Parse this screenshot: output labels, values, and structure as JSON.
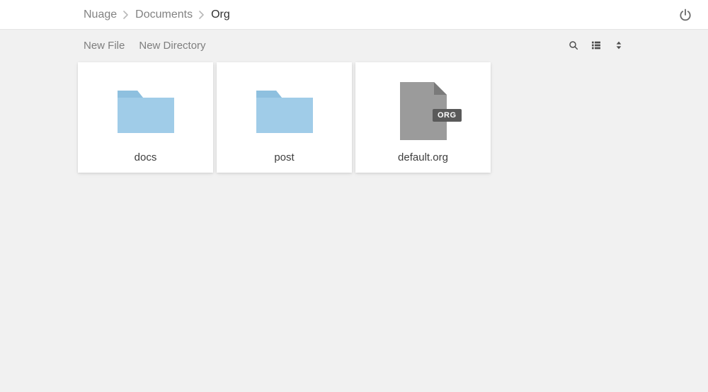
{
  "breadcrumb": {
    "items": [
      {
        "label": "Nuage",
        "current": false
      },
      {
        "label": "Documents",
        "current": false
      },
      {
        "label": "Org",
        "current": true
      }
    ]
  },
  "toolbar": {
    "new_file_label": "New File",
    "new_directory_label": "New Directory"
  },
  "files": [
    {
      "name": "docs",
      "type": "folder"
    },
    {
      "name": "post",
      "type": "folder"
    },
    {
      "name": "default.org",
      "type": "file",
      "ext_badge": "ORG"
    }
  ],
  "colors": {
    "folder_fill": "#a0cce8",
    "folder_tab": "#8ec0df",
    "file_fill": "#9b9b9b",
    "file_fold": "#7a7a7a",
    "badge_bg": "#5a5a5a",
    "icon_gray": "#6b6b6b"
  }
}
